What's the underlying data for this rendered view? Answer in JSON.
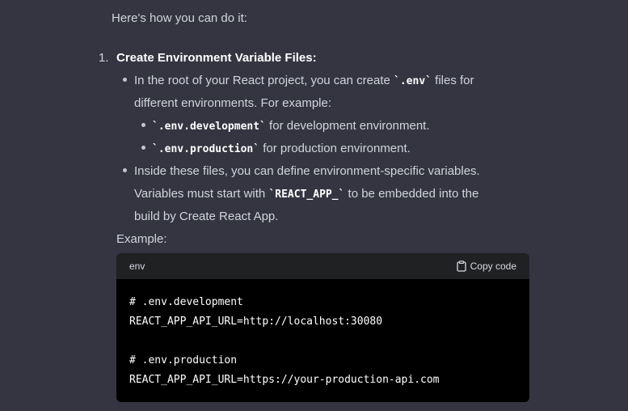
{
  "intro": "Here's how you can do it:",
  "step": {
    "number": "1.",
    "heading": "Create Environment Variable Files:"
  },
  "bullets": {
    "b1": {
      "part1": "In the root of your React project, you can create ",
      "code": "`.env`",
      "part2": " files for",
      "line2": "different environments. For example:"
    },
    "sub1": {
      "code": "`.env.development`",
      "text": " for development environment."
    },
    "sub2": {
      "code": "`.env.production`",
      "text": " for production environment."
    },
    "b2": {
      "line1": "Inside these files, you can define environment-specific variables.",
      "line2a": "Variables must start with ",
      "code": "`REACT_APP_`",
      "line2b": " to be embedded into the",
      "line3": "build by Create React App."
    }
  },
  "example_label": "Example:",
  "codeblock": {
    "language": "env",
    "copy_label": "Copy code",
    "lines": [
      "# .env.development",
      "REACT_APP_API_URL=http://localhost:30080",
      "",
      "# .env.production",
      "REACT_APP_API_URL=https://your-production-api.com"
    ]
  }
}
